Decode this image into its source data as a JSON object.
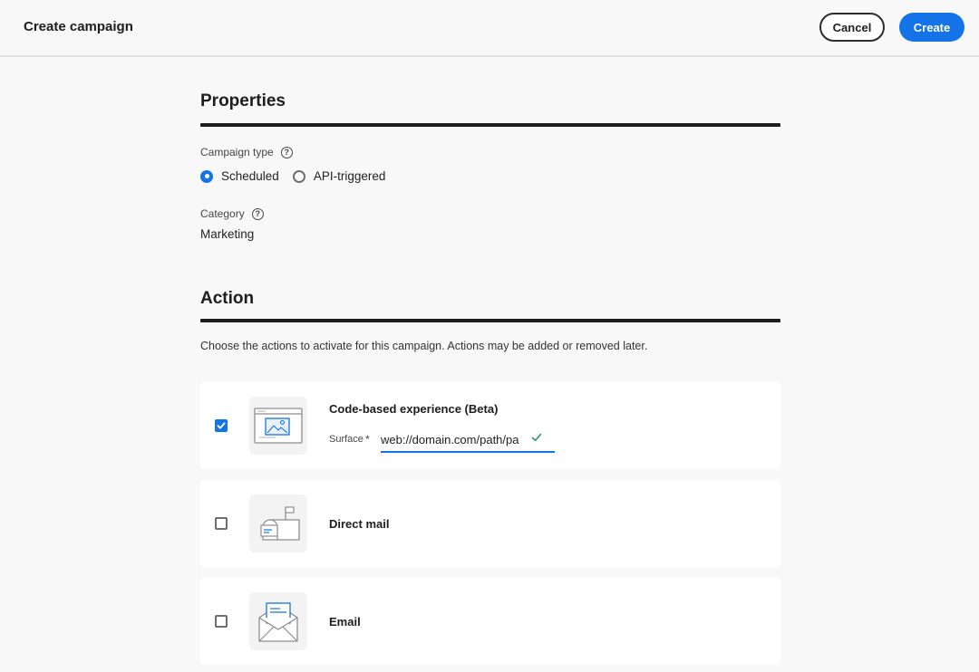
{
  "header": {
    "title": "Create campaign",
    "cancel_label": "Cancel",
    "create_label": "Create"
  },
  "properties": {
    "section_title": "Properties",
    "campaign_type": {
      "label": "Campaign type",
      "options": [
        {
          "label": "Scheduled",
          "selected": true
        },
        {
          "label": "API-triggered",
          "selected": false
        }
      ]
    },
    "category": {
      "label": "Category",
      "value": "Marketing"
    }
  },
  "action": {
    "section_title": "Action",
    "description": "Choose the actions to activate for this campaign. Actions may be added or removed later.",
    "items": [
      {
        "label": "Code-based experience (Beta)",
        "checked": true,
        "icon": "code-based-experience-icon",
        "surface": {
          "label": "Surface",
          "required_mark": "*",
          "value": "web://domain.com/path/pa",
          "valid": true
        }
      },
      {
        "label": "Direct mail",
        "checked": false,
        "icon": "mailbox-icon"
      },
      {
        "label": "Email",
        "checked": false,
        "icon": "envelope-icon"
      }
    ]
  },
  "colors": {
    "accent": "#1473e6",
    "valid": "#2d9d78",
    "text": "#1d1d1d",
    "background": "#f8f8f8"
  }
}
